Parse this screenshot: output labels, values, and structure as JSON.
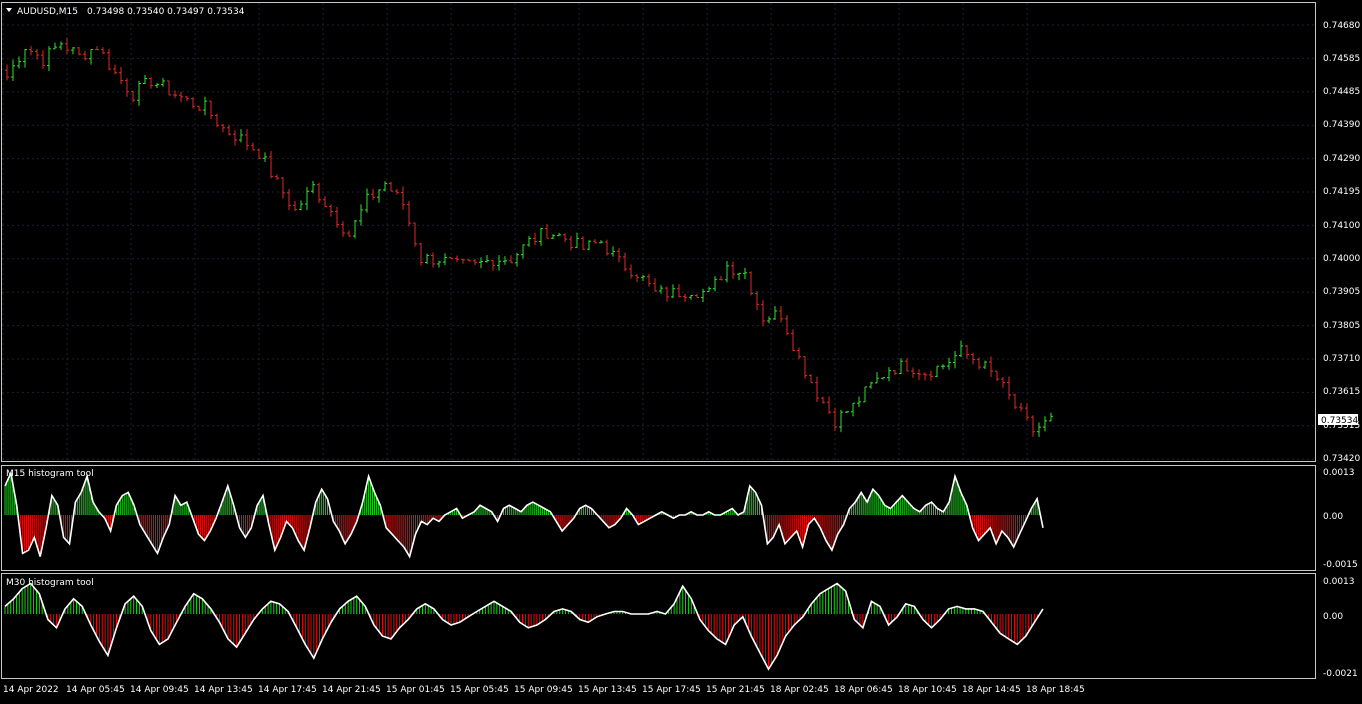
{
  "header": {
    "symbol": "AUDUSD,M15",
    "quote": "0.73498 0.73540 0.73497 0.73534"
  },
  "colors": {
    "background": "#000000",
    "frame": "#c8c8c8",
    "bull": "#2fe12f",
    "bear": "#e02a2a",
    "grid": "#1f1f3a",
    "indicator_line": "#ffffff",
    "hist_pos": "#22cc22",
    "hist_neg": "#dd1111"
  },
  "chart_data": [
    {
      "type": "candlestick",
      "title": "AUDUSD,M15",
      "price_ylim": [
        0.7342,
        0.7469
      ],
      "y_ticks": [
        "0.74680",
        "0.74585",
        "0.74485",
        "0.74390",
        "0.74290",
        "0.74195",
        "0.74100",
        "0.74000",
        "0.73905",
        "0.73805",
        "0.73710",
        "0.73615",
        "0.73515",
        "0.73420"
      ],
      "current_price": "0.73534",
      "x_ticks": [
        "14 Apr 2022",
        "14 Apr 05:45",
        "14 Apr 09:45",
        "14 Apr 13:45",
        "14 Apr 17:45",
        "14 Apr 21:45",
        "15 Apr 01:45",
        "15 Apr 05:45",
        "15 Apr 09:45",
        "15 Apr 13:45",
        "15 Apr 17:45",
        "15 Apr 21:45",
        "18 Apr 02:45",
        "18 Apr 06:45",
        "18 Apr 10:45",
        "18 Apr 14:45",
        "18 Apr 18:45"
      ],
      "close_path": [
        [
          0,
          0.7453
        ],
        [
          3,
          0.7462
        ],
        [
          6,
          0.7458
        ],
        [
          9,
          0.7463
        ],
        [
          12,
          0.7459
        ],
        [
          15,
          0.7462
        ],
        [
          18,
          0.7454
        ],
        [
          21,
          0.7448
        ],
        [
          24,
          0.7452
        ],
        [
          27,
          0.7449
        ],
        [
          30,
          0.7446
        ],
        [
          33,
          0.7444
        ],
        [
          36,
          0.7438
        ],
        [
          39,
          0.7435
        ],
        [
          42,
          0.7431
        ],
        [
          45,
          0.7422
        ],
        [
          48,
          0.7414
        ],
        [
          51,
          0.7421
        ],
        [
          54,
          0.7414
        ],
        [
          57,
          0.7407
        ],
        [
          60,
          0.7417
        ],
        [
          63,
          0.7422
        ],
        [
          66,
          0.7416
        ],
        [
          69,
          0.74
        ],
        [
          72,
          0.74
        ],
        [
          75,
          0.7398
        ],
        [
          78,
          0.7398
        ],
        [
          81,
          0.74
        ],
        [
          84,
          0.74
        ],
        [
          87,
          0.7405
        ],
        [
          90,
          0.7408
        ],
        [
          93,
          0.7406
        ],
        [
          96,
          0.7403
        ],
        [
          99,
          0.7405
        ],
        [
          102,
          0.7399
        ],
        [
          105,
          0.7396
        ],
        [
          108,
          0.739
        ],
        [
          111,
          0.739
        ],
        [
          114,
          0.7391
        ],
        [
          117,
          0.739
        ],
        [
          120,
          0.7398
        ],
        [
          123,
          0.7396
        ],
        [
          126,
          0.7383
        ],
        [
          129,
          0.7384
        ],
        [
          132,
          0.7371
        ],
        [
          135,
          0.7361
        ],
        [
          138,
          0.7353
        ],
        [
          141,
          0.7357
        ],
        [
          144,
          0.7363
        ],
        [
          147,
          0.7368
        ],
        [
          150,
          0.7369
        ],
        [
          153,
          0.7367
        ],
        [
          156,
          0.7369
        ],
        [
          159,
          0.7373
        ],
        [
          162,
          0.737
        ],
        [
          165,
          0.7365
        ],
        [
          168,
          0.7357
        ],
        [
          171,
          0.735
        ],
        [
          174,
          0.7353
        ]
      ],
      "candle_count": 175
    },
    {
      "type": "histogram",
      "title": "M15 histogram tool",
      "ylim": [
        -0.0015,
        0.0013
      ],
      "y_ticks": [
        "0.0013",
        "0.00",
        "-0.0015"
      ],
      "values": [
        0.0009,
        0.0013,
        0.0003,
        -0.0012,
        -0.0011,
        -0.0007,
        -0.0013,
        -0.0004,
        0.0006,
        0.0003,
        -0.0007,
        -0.0009,
        0.0004,
        0.0007,
        0.0012,
        0.0004,
        0.0001,
        -0.0001,
        -0.0005,
        0.0003,
        0.0006,
        0.0007,
        0.0003,
        -0.0003,
        -0.0006,
        -0.0009,
        -0.0012,
        -0.0007,
        -0.0003,
        0.0006,
        0.0003,
        0.0004,
        -0.0001,
        -0.0006,
        -0.0008,
        -0.0005,
        -0.0001,
        0.0004,
        0.0009,
        0.0003,
        -0.0004,
        -0.0007,
        -0.0004,
        0.0003,
        0.0006,
        -0.0003,
        -0.0011,
        -0.0007,
        -0.0002,
        -0.0004,
        -0.0008,
        -0.0011,
        -0.0004,
        0.0004,
        0.0008,
        0.0005,
        -0.0002,
        -0.0005,
        -0.0009,
        -0.0006,
        -0.0002,
        0.0004,
        0.0012,
        0.0007,
        0.0003,
        -0.0004,
        -0.0006,
        -0.0008,
        -0.001,
        -0.0013,
        -0.0006,
        -0.0002,
        -0.0003,
        -0.0001,
        -0.0002,
        0.0,
        0.0001,
        0.0002,
        -0.0001,
        0.0,
        0.0001,
        0.0003,
        0.0002,
        0.0001,
        -0.0002,
        0.0002,
        0.0003,
        0.0002,
        0.0001,
        0.0003,
        0.0004,
        0.0003,
        0.0002,
        0.0001,
        -0.0002,
        -0.0005,
        -0.0003,
        -0.0001,
        0.0002,
        0.0003,
        0.0002,
        0.0,
        -0.0002,
        -0.0004,
        -0.0003,
        -0.0001,
        0.0002,
        0.0,
        -0.0003,
        -0.0002,
        -0.0001,
        0.0,
        0.0001,
        0.0,
        -0.0001,
        0.0,
        0.0,
        0.0001,
        0.0,
        0.0,
        0.0001,
        0.0,
        0.0,
        0.0001,
        0.0002,
        0.0,
        0.0001,
        0.0009,
        0.0007,
        0.0003,
        -0.0009,
        -0.0007,
        -0.0003,
        -0.0009,
        -0.0007,
        -0.0005,
        -0.001,
        -0.0003,
        -0.0001,
        -0.0004,
        -0.0008,
        -0.0011,
        -0.0006,
        -0.0003,
        0.0002,
        0.0004,
        0.0007,
        0.0004,
        0.0008,
        0.0006,
        0.0003,
        0.0002,
        0.0004,
        0.0006,
        0.0004,
        0.0002,
        0.0001,
        0.0003,
        0.0004,
        0.0002,
        0.0001,
        0.0004,
        0.0012,
        0.0007,
        0.0003,
        -0.0004,
        -0.0008,
        -0.0006,
        -0.0004,
        -0.0009,
        -0.0005,
        -0.0007,
        -0.001,
        -0.0006,
        -0.0002,
        0.0002,
        0.0005,
        -0.0004
      ]
    },
    {
      "type": "histogram",
      "title": "M30 histogram tool",
      "ylim": [
        -0.0021,
        0.0013
      ],
      "y_ticks": [
        "0.0013",
        "0.00",
        "-0.0021"
      ],
      "values": [
        0.0003,
        0.0006,
        0.001,
        0.0012,
        0.0008,
        -0.0002,
        -0.0005,
        0.0002,
        0.0006,
        0.0003,
        -0.0004,
        -0.001,
        -0.0015,
        -0.0005,
        0.0004,
        0.0007,
        0.0003,
        -0.0006,
        -0.0011,
        -0.0009,
        -0.0003,
        0.0003,
        0.0008,
        0.0006,
        0.0002,
        -0.0003,
        -0.0009,
        -0.0012,
        -0.0007,
        -0.0002,
        0.0002,
        0.0005,
        0.0004,
        0.0001,
        -0.0005,
        -0.0011,
        -0.0016,
        -0.0009,
        -0.0003,
        0.0002,
        0.0005,
        0.0007,
        0.0003,
        -0.0004,
        -0.0008,
        -0.0009,
        -0.0005,
        -0.0002,
        0.0002,
        0.0004,
        0.0002,
        -0.0002,
        -0.0004,
        -0.0003,
        -0.0001,
        0.0001,
        0.0003,
        0.0005,
        0.0003,
        0.0001,
        -0.0003,
        -0.0005,
        -0.0004,
        -0.0002,
        0.0001,
        0.0002,
        0.0001,
        -0.0002,
        -0.0003,
        -0.0001,
        0.0,
        0.0001,
        0.0001,
        0.0,
        0.0,
        0.0,
        0.0001,
        0.0,
        0.0004,
        0.0011,
        0.0006,
        -0.0002,
        -0.0006,
        -0.0009,
        -0.0011,
        -0.0004,
        -0.0001,
        -0.0008,
        -0.0014,
        -0.002,
        -0.0015,
        -0.0008,
        -0.0004,
        -0.0001,
        0.0004,
        0.0008,
        0.001,
        0.0012,
        0.0009,
        -0.0002,
        -0.0005,
        0.0005,
        0.0003,
        -0.0004,
        -0.0001,
        0.0004,
        0.0003,
        -0.0002,
        -0.0005,
        -0.0002,
        0.0002,
        0.0003,
        0.0002,
        0.0002,
        0.0001,
        -0.0003,
        -0.0007,
        -0.0009,
        -0.0011,
        -0.0008,
        -0.0003,
        0.0002
      ]
    }
  ]
}
